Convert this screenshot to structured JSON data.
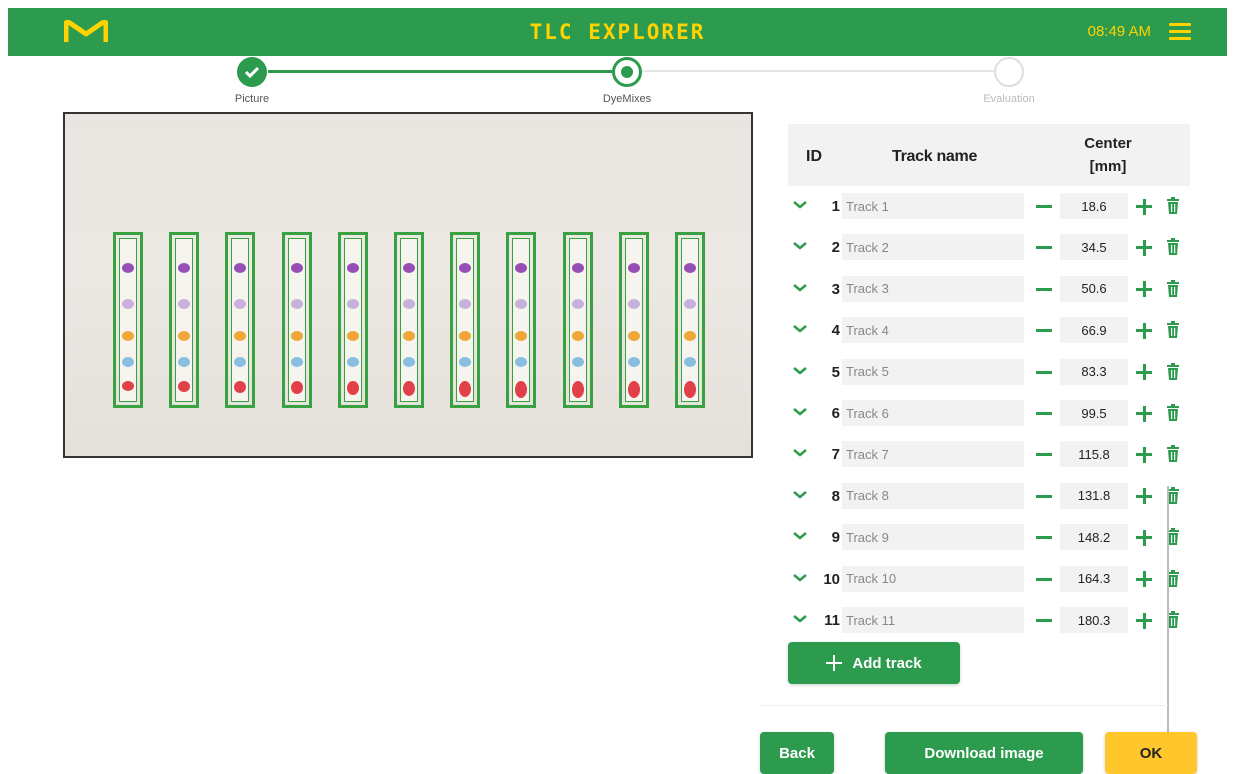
{
  "header": {
    "title": "TLC EXPLORER",
    "time": "08:49 AM",
    "logo": "m-logo",
    "menu_icon": "hamburger-icon"
  },
  "stepper": {
    "steps": [
      {
        "label": "Picture",
        "state": "done"
      },
      {
        "label": "DyeMixes",
        "state": "active"
      },
      {
        "label": "Evaluation",
        "state": "todo"
      }
    ]
  },
  "plate": {
    "lanes": 11,
    "spot_colors": [
      "#8e3fb0",
      "#b79ad6",
      "#f0a028",
      "#7fb8e0",
      "#e0303a"
    ]
  },
  "table": {
    "headers": {
      "id": "ID",
      "name": "Track name",
      "center_line1": "Center",
      "center_line2": "[mm]"
    },
    "rows": [
      {
        "id": "1",
        "name": "Track 1",
        "center": "18.6"
      },
      {
        "id": "2",
        "name": "Track 2",
        "center": "34.5"
      },
      {
        "id": "3",
        "name": "Track 3",
        "center": "50.6"
      },
      {
        "id": "4",
        "name": "Track 4",
        "center": "66.9"
      },
      {
        "id": "5",
        "name": "Track 5",
        "center": "83.3"
      },
      {
        "id": "6",
        "name": "Track 6",
        "center": "99.5"
      },
      {
        "id": "7",
        "name": "Track 7",
        "center": "115.8"
      },
      {
        "id": "8",
        "name": "Track 8",
        "center": "131.8"
      },
      {
        "id": "9",
        "name": "Track 9",
        "center": "148.2"
      },
      {
        "id": "10",
        "name": "Track 10",
        "center": "164.3"
      },
      {
        "id": "11",
        "name": "Track 11",
        "center": "180.3"
      }
    ]
  },
  "actions": {
    "add_track": "Add track",
    "back": "Back",
    "download": "Download image",
    "ok": "OK"
  },
  "colors": {
    "brand_green": "#2d9b4d",
    "accent_yellow": "#ffd200",
    "ok_yellow": "#ffc72c"
  }
}
